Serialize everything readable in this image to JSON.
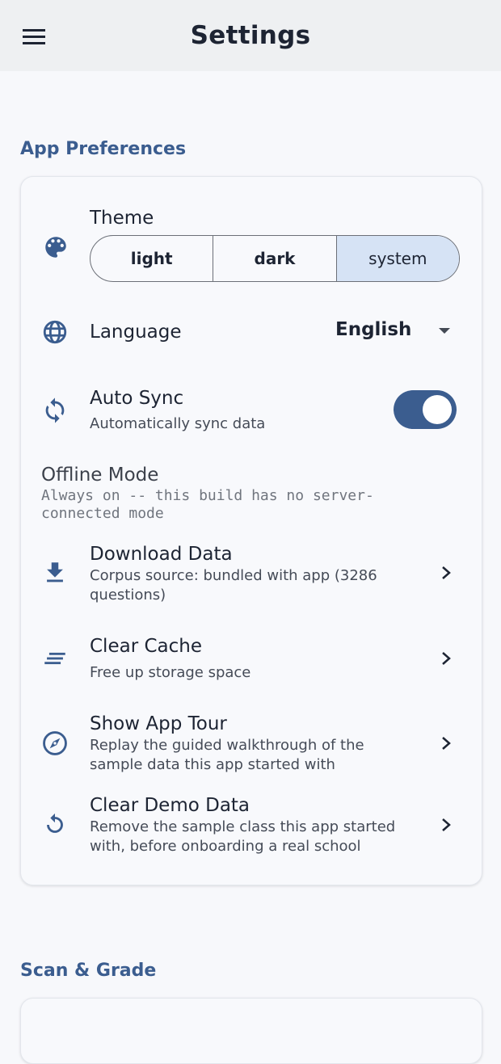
{
  "appbar": {
    "title": "Settings",
    "menu_icon": "menu-icon"
  },
  "sections": {
    "app_preferences": "App Preferences",
    "scan_grade": "Scan & Grade"
  },
  "theme": {
    "label": "Theme",
    "icon": "palette-icon",
    "options": [
      "light",
      "dark",
      "system"
    ],
    "selected": "system"
  },
  "language": {
    "label": "Language",
    "value": "English",
    "icon": "globe-icon"
  },
  "auto_sync": {
    "title": "Auto Sync",
    "subtitle": "Automatically sync data",
    "enabled": true,
    "icon": "sync-icon"
  },
  "offline_mode": {
    "title": "Offline Mode",
    "subtitle": "Always on -- this build has no server-connected mode"
  },
  "download_data": {
    "title": "Download Data",
    "subtitle": "Corpus source: bundled with app (3286 questions)",
    "icon": "download-icon"
  },
  "clear_cache": {
    "title": "Clear Cache",
    "subtitle": "Free up storage space",
    "icon": "clear-lines-icon"
  },
  "app_tour": {
    "title": "Show App Tour",
    "subtitle": "Replay the guided walkthrough of the sample data this app started with",
    "icon": "compass-icon"
  },
  "clear_demo": {
    "title": "Clear Demo Data",
    "subtitle": "Remove the sample class this app started with, before onboarding a real school",
    "icon": "restart-icon"
  },
  "colors": {
    "accent": "#3b5d8f",
    "selected_segment": "#d6e3f5",
    "appbar_bg": "#eef0f2",
    "page_bg": "#f7f8fb"
  }
}
